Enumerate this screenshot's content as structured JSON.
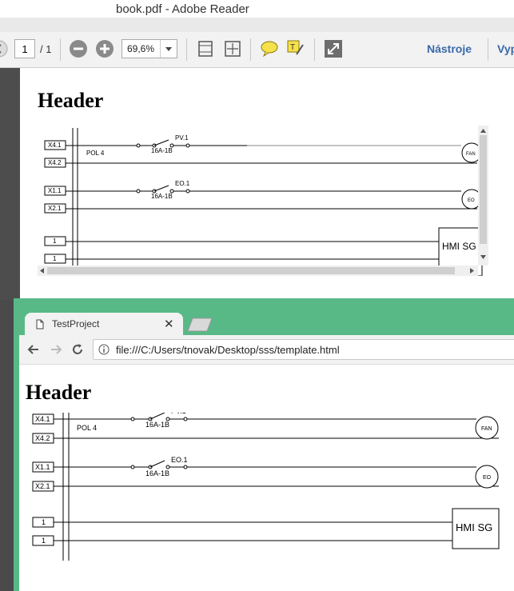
{
  "reader": {
    "window_title": "book.pdf - Adobe Reader",
    "page_current": "1",
    "page_total": "/ 1",
    "zoom": "69,6%",
    "tools_label": "Nástroje",
    "tools_label2": "Vyp"
  },
  "document": {
    "header": "Header",
    "rows": [
      {
        "label": "X4.1",
        "breaker": "16A-1B",
        "switch_label": "PV.1",
        "load": "FAN"
      },
      {
        "label": "X4.2"
      },
      {
        "label": "X1.1",
        "breaker": "16A-1B",
        "switch_label": "EO.1",
        "load": "EO"
      },
      {
        "label": "X2.1"
      },
      {
        "label": "1"
      },
      {
        "label": "1"
      }
    ],
    "group_label": "POL 4",
    "hmi_label": "HMI SG"
  },
  "browser": {
    "tab_title": "TestProject",
    "url": "file:///C:/Users/tnovak/Desktop/sss/template.html"
  },
  "icons": [
    "page-icon",
    "info-icon",
    "back-arrow-icon",
    "forward-arrow-icon",
    "reload-icon",
    "close-icon",
    "zoom-out-icon",
    "zoom-in-icon",
    "comment-icon",
    "sign-icon",
    "expand-icon",
    "fit-page-icon",
    "scroll-mode-icon"
  ]
}
